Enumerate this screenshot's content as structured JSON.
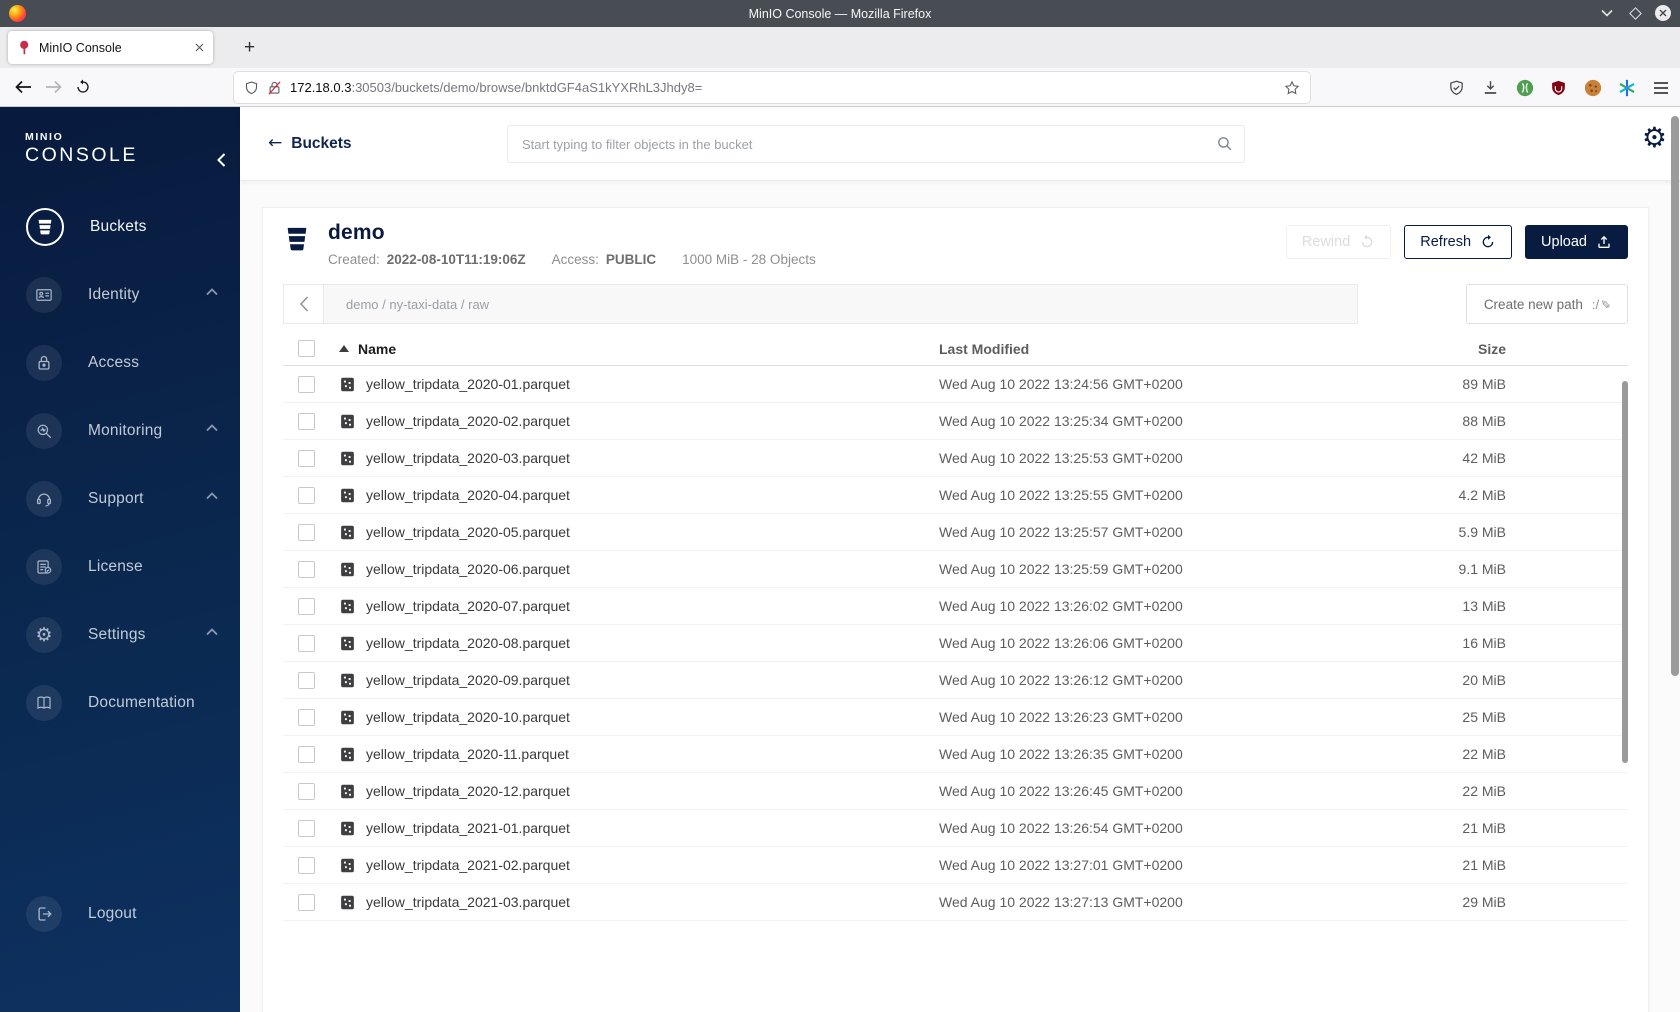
{
  "browser": {
    "window_title": "MinIO Console — Mozilla Firefox",
    "tab_title": "MinIO Console",
    "new_tab_label": "+",
    "url_host": "172.18.0.3",
    "url_rest": ":30503/buckets/demo/browse/bnktdGF4aS1kYXRhL3Jhdy8="
  },
  "icons": {
    "gear": "⚙",
    "pencil": "✎",
    "path_slashes": ":/",
    "back_arrow": "←"
  },
  "sidebar": {
    "logo_line1": "MINIO",
    "logo_line2": "CONSOLE",
    "items": [
      {
        "label": "Buckets",
        "active": true,
        "expandable": false
      },
      {
        "label": "Identity",
        "active": false,
        "expandable": true
      },
      {
        "label": "Access",
        "active": false,
        "expandable": false
      },
      {
        "label": "Monitoring",
        "active": false,
        "expandable": true
      },
      {
        "label": "Support",
        "active": false,
        "expandable": true
      },
      {
        "label": "License",
        "active": false,
        "expandable": false
      },
      {
        "label": "Settings",
        "active": false,
        "expandable": true
      },
      {
        "label": "Documentation",
        "active": false,
        "expandable": false
      }
    ],
    "logout_label": "Logout"
  },
  "header": {
    "back_label": "Buckets",
    "search_placeholder": "Start typing to filter objects in the bucket"
  },
  "bucket": {
    "name": "demo",
    "created_label": "Created:",
    "created": "2022-08-10T11:19:06Z",
    "access_label": "Access:",
    "access": "PUBLIC",
    "usage": "1000 MiB - 28 Objects",
    "rewind_label": "Rewind",
    "refresh_label": "Refresh",
    "upload_label": "Upload"
  },
  "path_bar": {
    "breadcrumb": "demo / ny-taxi-data / raw",
    "segments": [
      "demo",
      "ny-taxi-data",
      "raw"
    ],
    "create_path_label": "Create new path"
  },
  "table": {
    "columns": {
      "name": "Name",
      "modified": "Last Modified",
      "size": "Size"
    },
    "sort": {
      "column": "Name",
      "direction": "asc"
    },
    "rows": [
      {
        "name": "yellow_tripdata_2020-01.parquet",
        "modified": "Wed Aug 10 2022 13:24:56 GMT+0200",
        "size": "89 MiB"
      },
      {
        "name": "yellow_tripdata_2020-02.parquet",
        "modified": "Wed Aug 10 2022 13:25:34 GMT+0200",
        "size": "88 MiB"
      },
      {
        "name": "yellow_tripdata_2020-03.parquet",
        "modified": "Wed Aug 10 2022 13:25:53 GMT+0200",
        "size": "42 MiB"
      },
      {
        "name": "yellow_tripdata_2020-04.parquet",
        "modified": "Wed Aug 10 2022 13:25:55 GMT+0200",
        "size": "4.2 MiB"
      },
      {
        "name": "yellow_tripdata_2020-05.parquet",
        "modified": "Wed Aug 10 2022 13:25:57 GMT+0200",
        "size": "5.9 MiB"
      },
      {
        "name": "yellow_tripdata_2020-06.parquet",
        "modified": "Wed Aug 10 2022 13:25:59 GMT+0200",
        "size": "9.1 MiB"
      },
      {
        "name": "yellow_tripdata_2020-07.parquet",
        "modified": "Wed Aug 10 2022 13:26:02 GMT+0200",
        "size": "13 MiB"
      },
      {
        "name": "yellow_tripdata_2020-08.parquet",
        "modified": "Wed Aug 10 2022 13:26:06 GMT+0200",
        "size": "16 MiB"
      },
      {
        "name": "yellow_tripdata_2020-09.parquet",
        "modified": "Wed Aug 10 2022 13:26:12 GMT+0200",
        "size": "20 MiB"
      },
      {
        "name": "yellow_tripdata_2020-10.parquet",
        "modified": "Wed Aug 10 2022 13:26:23 GMT+0200",
        "size": "25 MiB"
      },
      {
        "name": "yellow_tripdata_2020-11.parquet",
        "modified": "Wed Aug 10 2022 13:26:35 GMT+0200",
        "size": "22 MiB"
      },
      {
        "name": "yellow_tripdata_2020-12.parquet",
        "modified": "Wed Aug 10 2022 13:26:45 GMT+0200",
        "size": "22 MiB"
      },
      {
        "name": "yellow_tripdata_2021-01.parquet",
        "modified": "Wed Aug 10 2022 13:26:54 GMT+0200",
        "size": "21 MiB"
      },
      {
        "name": "yellow_tripdata_2021-02.parquet",
        "modified": "Wed Aug 10 2022 13:27:01 GMT+0200",
        "size": "21 MiB"
      },
      {
        "name": "yellow_tripdata_2021-03.parquet",
        "modified": "Wed Aug 10 2022 13:27:13 GMT+0200",
        "size": "29 MiB"
      }
    ]
  },
  "colors": {
    "accent_navy": "#081c42",
    "sidebar_gradient_top": "#081a3d",
    "sidebar_gradient_bottom": "#0e3161",
    "titlebar": "#474d52",
    "favicon_red": "#c72e49"
  }
}
